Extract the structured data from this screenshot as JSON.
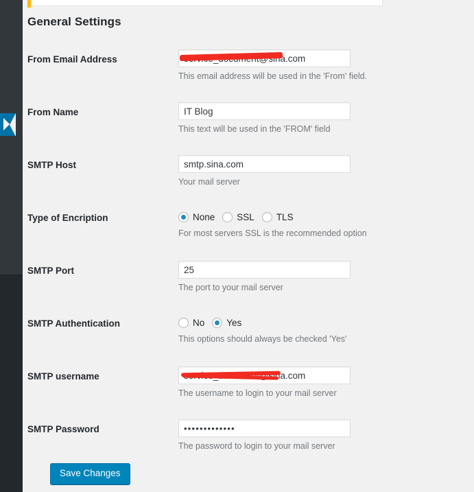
{
  "app": {
    "page_title": "General Settings",
    "accent_color": "#ffb900",
    "sidebar_color": "#23282d",
    "sidebar_upper_color": "#32373c",
    "button_color": "#0085ba",
    "radio_checked_color": "#1e8cbe",
    "redaction_color": "#f02b21"
  },
  "sidebar": {
    "collapse_icon": "chevron-left-icon"
  },
  "form": {
    "rows": [
      {
        "label": "From Email Address",
        "type": "text",
        "value": "service_document@sina.com",
        "redacted": true,
        "description": "This email address will be used in the 'From' field."
      },
      {
        "label": "From Name",
        "type": "text",
        "value": "IT Blog",
        "redacted": false,
        "description": "This text will be used in the 'FROM' field"
      },
      {
        "label": "SMTP Host",
        "type": "text",
        "value": "smtp.sina.com",
        "redacted": false,
        "description": "Your mail server"
      },
      {
        "label": "Type of Encription",
        "type": "radio",
        "options": [
          {
            "label": "None",
            "checked": true
          },
          {
            "label": "SSL",
            "checked": false
          },
          {
            "label": "TLS",
            "checked": false
          }
        ],
        "description": "For most servers SSL is the recommended option"
      },
      {
        "label": "SMTP Port",
        "type": "text",
        "value": "25",
        "redacted": false,
        "description": "The port to your mail server"
      },
      {
        "label": "SMTP Authentication",
        "type": "radio",
        "options": [
          {
            "label": "No",
            "checked": false
          },
          {
            "label": "Yes",
            "checked": true
          }
        ],
        "description": "This options should always be checked 'Yes'"
      },
      {
        "label": "SMTP username",
        "type": "text",
        "value": "service_document@sina.com",
        "redacted": true,
        "description": "The username to login to your mail server"
      },
      {
        "label": "SMTP Password",
        "type": "password",
        "value": "•••••••••••••",
        "redacted": false,
        "description": "The password to login to your mail server"
      }
    ]
  },
  "actions": {
    "save_label": "Save Changes"
  }
}
